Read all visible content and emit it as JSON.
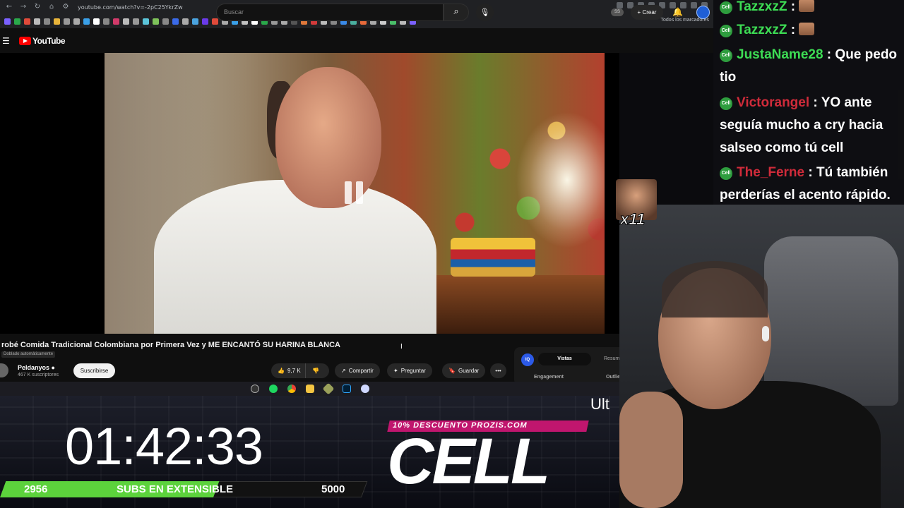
{
  "browser": {
    "url": "youtube.com/watch?v=-2pC25YkrZw",
    "bookmarks_folder": "Todos los marcadores",
    "bookmark_colors": [
      "#7b61ff",
      "#2aa84a",
      "#e04a3a",
      "#bbbbbb",
      "#888888",
      "#e8b43a",
      "#999999",
      "#aaaaaa",
      "#3aa0e8",
      "#ffffff",
      "#888888",
      "#d23a6a",
      "#bbbbbb",
      "#999999",
      "#5bc4d9",
      "#7ec25a",
      "#888888",
      "#3a6ae8",
      "#aaaaaa",
      "#4aa3df",
      "#6a3ae8",
      "#e04a3a",
      "#aaaaaa",
      "#3aa0e8",
      "#c2c2c2",
      "#ffffff",
      "#2aa84a",
      "#999999",
      "#aaaaaa",
      "#555555",
      "#e0783a",
      "#d23a3a",
      "#bbbbbb",
      "#888888",
      "#3a8ae8",
      "#4ab0a0",
      "#e86a3a",
      "#aaaaaa",
      "#cccccc",
      "#4abf6a",
      "#bbbbbb",
      "#7b61ff"
    ]
  },
  "youtube": {
    "logo_text": "YouTube",
    "search_placeholder": "Buscar",
    "ss_badge": "SS",
    "create_label": "Crear",
    "video_title": "robé Comida Tradicional Colombiana por Primera Vez y ME ENCANTÓ SU HARINA BLANCA",
    "dub_chip": "Doblado automáticamente",
    "channel_name": "Peldanyos",
    "channel_subs": "467 K suscriptores",
    "subscribe_label": "Suscribirse",
    "likes": "9,7 K",
    "share_label": "Compartir",
    "ask_label": "Preguntar",
    "save_label": "Guardar",
    "side_panel": {
      "badge": "IQ",
      "tab_active": "Vistas",
      "tab_other": "Resum",
      "label_left": "Engagement",
      "label_right": "Outlie"
    }
  },
  "taskbar": {
    "icons": [
      "obs-icon",
      "spotify-icon",
      "chrome-icon",
      "folder-icon",
      "app-icon",
      "photoshop-icon",
      "discord-icon"
    ]
  },
  "overlay": {
    "ult_text": "Ult",
    "timer": "01:42:33",
    "subs_current": "2956",
    "subs_label": "SUBS EN EXTENSIBLE",
    "subs_goal": "5000",
    "subs_progress": 0.59,
    "promo_text": "10% DESCUENTO PROZIS.COM",
    "brand_logo": "CELL",
    "emote_count": "x11"
  },
  "chat": {
    "badge_text": "Cell",
    "messages": [
      {
        "user": "TazzxzZ",
        "sep": " : ",
        "text": "",
        "emote": true
      },
      {
        "user": "TazzxzZ",
        "sep": " : ",
        "text": "",
        "emote": true
      },
      {
        "user": "JustaName28",
        "sep": " : ",
        "text": "Que pedo tio",
        "emote": false
      },
      {
        "user": "Victorangel",
        "sep": " : ",
        "text": "YO ante seguía mucho a cry hacia salseo como tú cell",
        "emote": false
      },
      {
        "user": "The_Ferne",
        "sep": " : ",
        "text": "Tú también perderías el acento rápido.",
        "emote": false
      }
    ]
  }
}
